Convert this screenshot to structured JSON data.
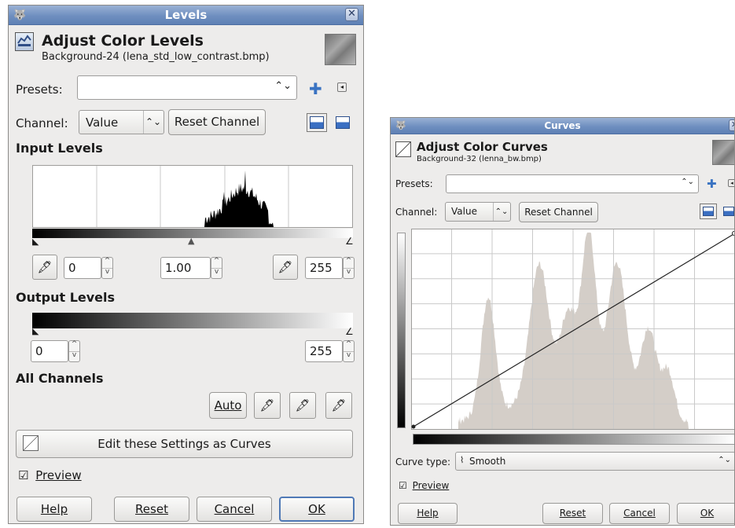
{
  "levels": {
    "title": "Levels",
    "header_title": "Adjust Color Levels",
    "header_subtitle": "Background-24 (lena_std_low_contrast.bmp)",
    "presets_label": "Presets:",
    "presets_value": "",
    "channel_label": "Channel:",
    "channel_value": "Value",
    "reset_channel": "Reset Channel",
    "input_levels_heading": "Input Levels",
    "input_low": "0",
    "input_gamma": "1.00",
    "input_high": "255",
    "output_levels_heading": "Output Levels",
    "output_low": "0",
    "output_high": "255",
    "all_channels_heading": "All Channels",
    "auto_button": "Auto",
    "edit_as_curves": "Edit these Settings as Curves",
    "preview_label": "Preview",
    "preview_checked": true,
    "help_button": "Help",
    "reset_button": "Reset",
    "cancel_button": "Cancel",
    "ok_button": "OK",
    "histogram_color": "#000000"
  },
  "curves": {
    "title": "Curves",
    "header_title": "Adjust Color Curves",
    "header_subtitle": "Background-32 (lenna_bw.bmp)",
    "presets_label": "Presets:",
    "presets_value": "",
    "channel_label": "Channel:",
    "channel_value": "Value",
    "reset_channel": "Reset Channel",
    "curve_type_label": "Curve type:",
    "curve_type_value": "Smooth",
    "preview_label": "Preview",
    "preview_checked": true,
    "help_button": "Help",
    "reset_button": "Reset",
    "cancel_button": "Cancel",
    "ok_button": "OK",
    "histogram_color": "#d4cec8"
  },
  "icons": {
    "app": "gimp-wilber-icon",
    "close": "close-icon",
    "add": "add-preset-icon",
    "menu": "preset-menu-icon",
    "picker": "color-picker-icon"
  }
}
